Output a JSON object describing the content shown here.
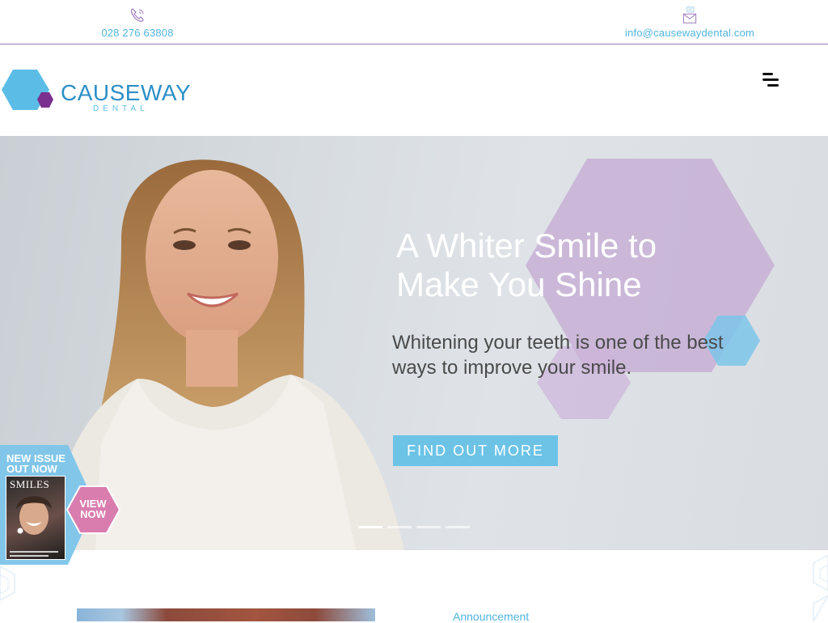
{
  "contact": {
    "phone": "028 276 63808",
    "email": "info@causewaydental.com",
    "phone_icon": "phone-icon",
    "email_icon": "envelope-icon"
  },
  "logo": {
    "name": "CAUSEWAY",
    "sub": "DENTAL"
  },
  "menu": {
    "icon": "hamburger-menu-icon"
  },
  "hero": {
    "title": "A Whiter Smile to Make You Shine",
    "subtitle": "Whitening your teeth is one of the best ways to improve your smile.",
    "cta": "FIND OUT MORE",
    "slides_total": 4,
    "active_slide": 1
  },
  "promo": {
    "line1": "NEW ISSUE",
    "line2": "OUT NOW",
    "magazine_title": "SMILES",
    "view_line1": "VIEW",
    "view_line2": "NOW"
  },
  "section": {
    "announcement": "Announcement"
  },
  "colors": {
    "accent_blue": "#6cc3e6",
    "link_blue": "#4fb4dc",
    "purple": "#7b2f8f",
    "pink": "#d97cae",
    "divider": "#9b7bb8"
  }
}
